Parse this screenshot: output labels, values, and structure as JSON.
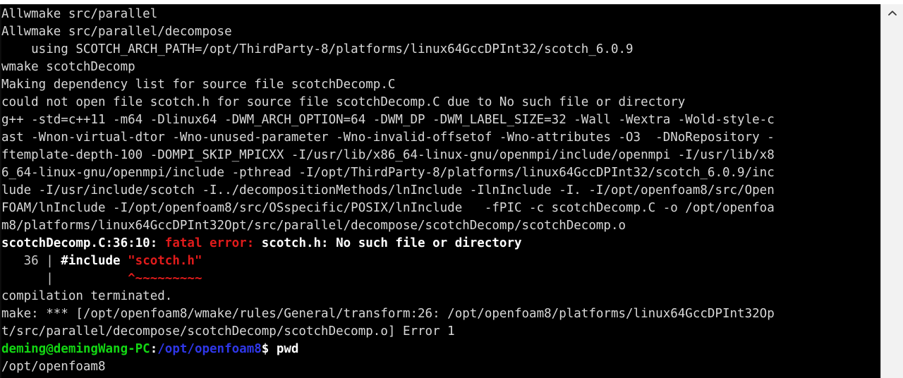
{
  "window": {
    "title": "deming@demingWang-PC: /opt/openfoam8",
    "background_color": "#000000",
    "foreground_color": "#d8d8d8"
  },
  "colors": {
    "default": "#d8d8d8",
    "bold_white": "#ffffff",
    "error_red": "#e01b1b",
    "prompt_green": "#13d613",
    "path_blue": "#2f37e8",
    "scrollbar_track": "#f2f2f2"
  },
  "scrollbar": {
    "up_arrow_icon": "chevron-up-icon",
    "position": "right",
    "visible": true
  },
  "terminal": {
    "lines": [
      {
        "id": "line-1",
        "segments": [
          {
            "text": "Allwmake src/parallel",
            "color": "default"
          }
        ]
      },
      {
        "id": "line-2",
        "segments": [
          {
            "text": "Allwmake src/parallel/decompose",
            "color": "default"
          }
        ]
      },
      {
        "id": "line-3",
        "segments": [
          {
            "text": "    using SCOTCH_ARCH_PATH=/opt/ThirdParty-8/platforms/linux64GccDPInt32/scotch_6.0.9",
            "color": "default"
          }
        ]
      },
      {
        "id": "line-4",
        "segments": [
          {
            "text": "wmake scotchDecomp",
            "color": "default"
          }
        ]
      },
      {
        "id": "line-5",
        "segments": [
          {
            "text": "Making dependency list for source file scotchDecomp.C",
            "color": "default"
          }
        ]
      },
      {
        "id": "line-6",
        "segments": [
          {
            "text": "could not open file scotch.h for source file scotchDecomp.C due to No such file or directory",
            "color": "default"
          }
        ]
      },
      {
        "id": "line-7",
        "segments": [
          {
            "text": "g++ -std=c++11 -m64 -Dlinux64 -DWM_ARCH_OPTION=64 -DWM_DP -DWM_LABEL_SIZE=32 -Wall -Wextra -Wold-style-c",
            "color": "default"
          }
        ]
      },
      {
        "id": "line-8",
        "segments": [
          {
            "text": "ast -Wnon-virtual-dtor -Wno-unused-parameter -Wno-invalid-offsetof -Wno-attributes -O3  -DNoRepository -",
            "color": "default"
          }
        ]
      },
      {
        "id": "line-9",
        "segments": [
          {
            "text": "ftemplate-depth-100 -DOMPI_SKIP_MPICXX -I/usr/lib/x86_64-linux-gnu/openmpi/include/openmpi -I/usr/lib/x8",
            "color": "default"
          }
        ]
      },
      {
        "id": "line-10",
        "segments": [
          {
            "text": "6_64-linux-gnu/openmpi/include -pthread -I/opt/ThirdParty-8/platforms/linux64GccDPInt32/scotch_6.0.9/inc",
            "color": "default"
          }
        ]
      },
      {
        "id": "line-11",
        "segments": [
          {
            "text": "lude -I/usr/include/scotch -I../decompositionMethods/lnInclude -IlnInclude -I. -I/opt/openfoam8/src/Open",
            "color": "default"
          }
        ]
      },
      {
        "id": "line-12",
        "segments": [
          {
            "text": "FOAM/lnInclude -I/opt/openfoam8/src/OSspecific/POSIX/lnInclude   -fPIC -c scotchDecomp.C -o /opt/openfoa",
            "color": "default"
          }
        ]
      },
      {
        "id": "line-13",
        "segments": [
          {
            "text": "m8/platforms/linux64GccDPInt32Opt/src/parallel/decompose/scotchDecomp/scotchDecomp.o",
            "color": "default"
          }
        ]
      },
      {
        "id": "line-14",
        "segments": [
          {
            "text": "scotchDecomp.C:36:10: ",
            "color": "bold_white"
          },
          {
            "text": "fatal error: ",
            "color": "error_red"
          },
          {
            "text": "scotch.h: No such file or directory",
            "color": "bold_white"
          }
        ]
      },
      {
        "id": "line-15",
        "segments": [
          {
            "text": "   36 | ",
            "color": "grey"
          },
          {
            "text": "#include ",
            "color": "bold_white"
          },
          {
            "text": "\"scotch.h\"",
            "color": "error_red"
          }
        ]
      },
      {
        "id": "line-16",
        "segments": [
          {
            "text": "      | ",
            "color": "grey"
          },
          {
            "text": "         ^~~~~~~~~~",
            "color": "error_red"
          }
        ]
      },
      {
        "id": "line-17",
        "segments": [
          {
            "text": "compilation terminated.",
            "color": "default"
          }
        ]
      },
      {
        "id": "line-18",
        "segments": [
          {
            "text": "make: *** [/opt/openfoam8/wmake/rules/General/transform:26: /opt/openfoam8/platforms/linux64GccDPInt32Op",
            "color": "default"
          }
        ]
      },
      {
        "id": "line-19",
        "segments": [
          {
            "text": "t/src/parallel/decompose/scotchDecomp/scotchDecomp.o] Error 1",
            "color": "default"
          }
        ]
      },
      {
        "id": "line-20",
        "segments": [
          {
            "text": "deming@demingWang-PC",
            "color": "prompt_green"
          },
          {
            "text": ":",
            "color": "bold_white"
          },
          {
            "text": "/opt/openfoam8",
            "color": "path_blue"
          },
          {
            "text": "$ pwd",
            "color": "bold_white"
          }
        ]
      },
      {
        "id": "line-21",
        "segments": [
          {
            "text": "/opt/openfoam8",
            "color": "default"
          }
        ]
      }
    ]
  }
}
